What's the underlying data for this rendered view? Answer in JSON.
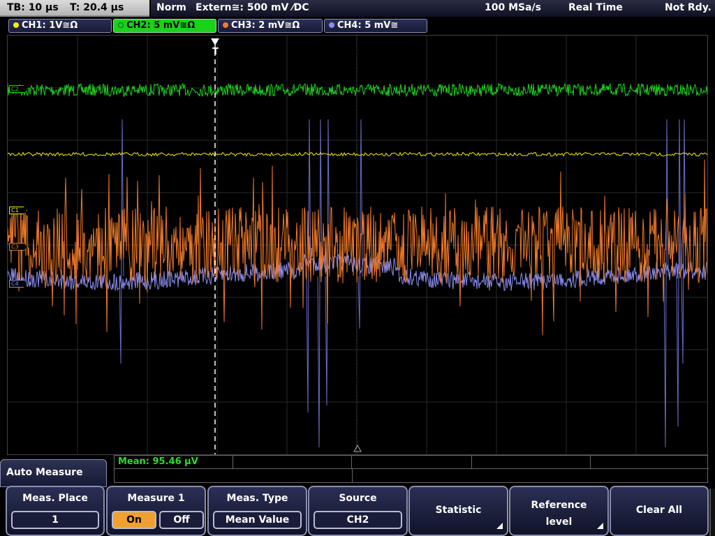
{
  "status": {
    "timebase": "TB: 10 µs",
    "trigger_time": "T: 20.4 µs",
    "acq_mode": "Norm",
    "trigger_info": "Extern≅: 500 mV ⁄DC",
    "sample_rate": "100 MSa/s",
    "time_mode": "Real Time",
    "ready_state": "Not Rdy."
  },
  "channels": [
    {
      "label": "CH1: 1V≅Ω",
      "color": "#f2f000"
    },
    {
      "label": "CH2: 5 mV≅Ω",
      "color": "#19d219",
      "active": true
    },
    {
      "label": "CH3: 2 mV≅Ω",
      "color": "#f07a28"
    },
    {
      "label": "CH4: 5 mV≅",
      "color": "#8a8ef0"
    }
  ],
  "markers": {
    "c1": "C1",
    "c2": "C2",
    "c3": "C3",
    "c4": "C4",
    "trigger": "T"
  },
  "measurement": {
    "result": "Mean: 95.46 µV"
  },
  "menu": {
    "title": "Auto Measure",
    "keys": {
      "meas_place": {
        "title": "Meas. Place",
        "value": "1"
      },
      "measure1": {
        "title": "Measure 1",
        "on": "On",
        "off": "Off"
      },
      "meas_type": {
        "title": "Meas. Type",
        "value": "Mean Value"
      },
      "source": {
        "title": "Source",
        "value": "CH2"
      },
      "statistic": {
        "label": "Statistic"
      },
      "reference_level": {
        "line1": "Reference",
        "line2": "level"
      },
      "clear_all": {
        "label": "Clear All"
      }
    }
  }
}
